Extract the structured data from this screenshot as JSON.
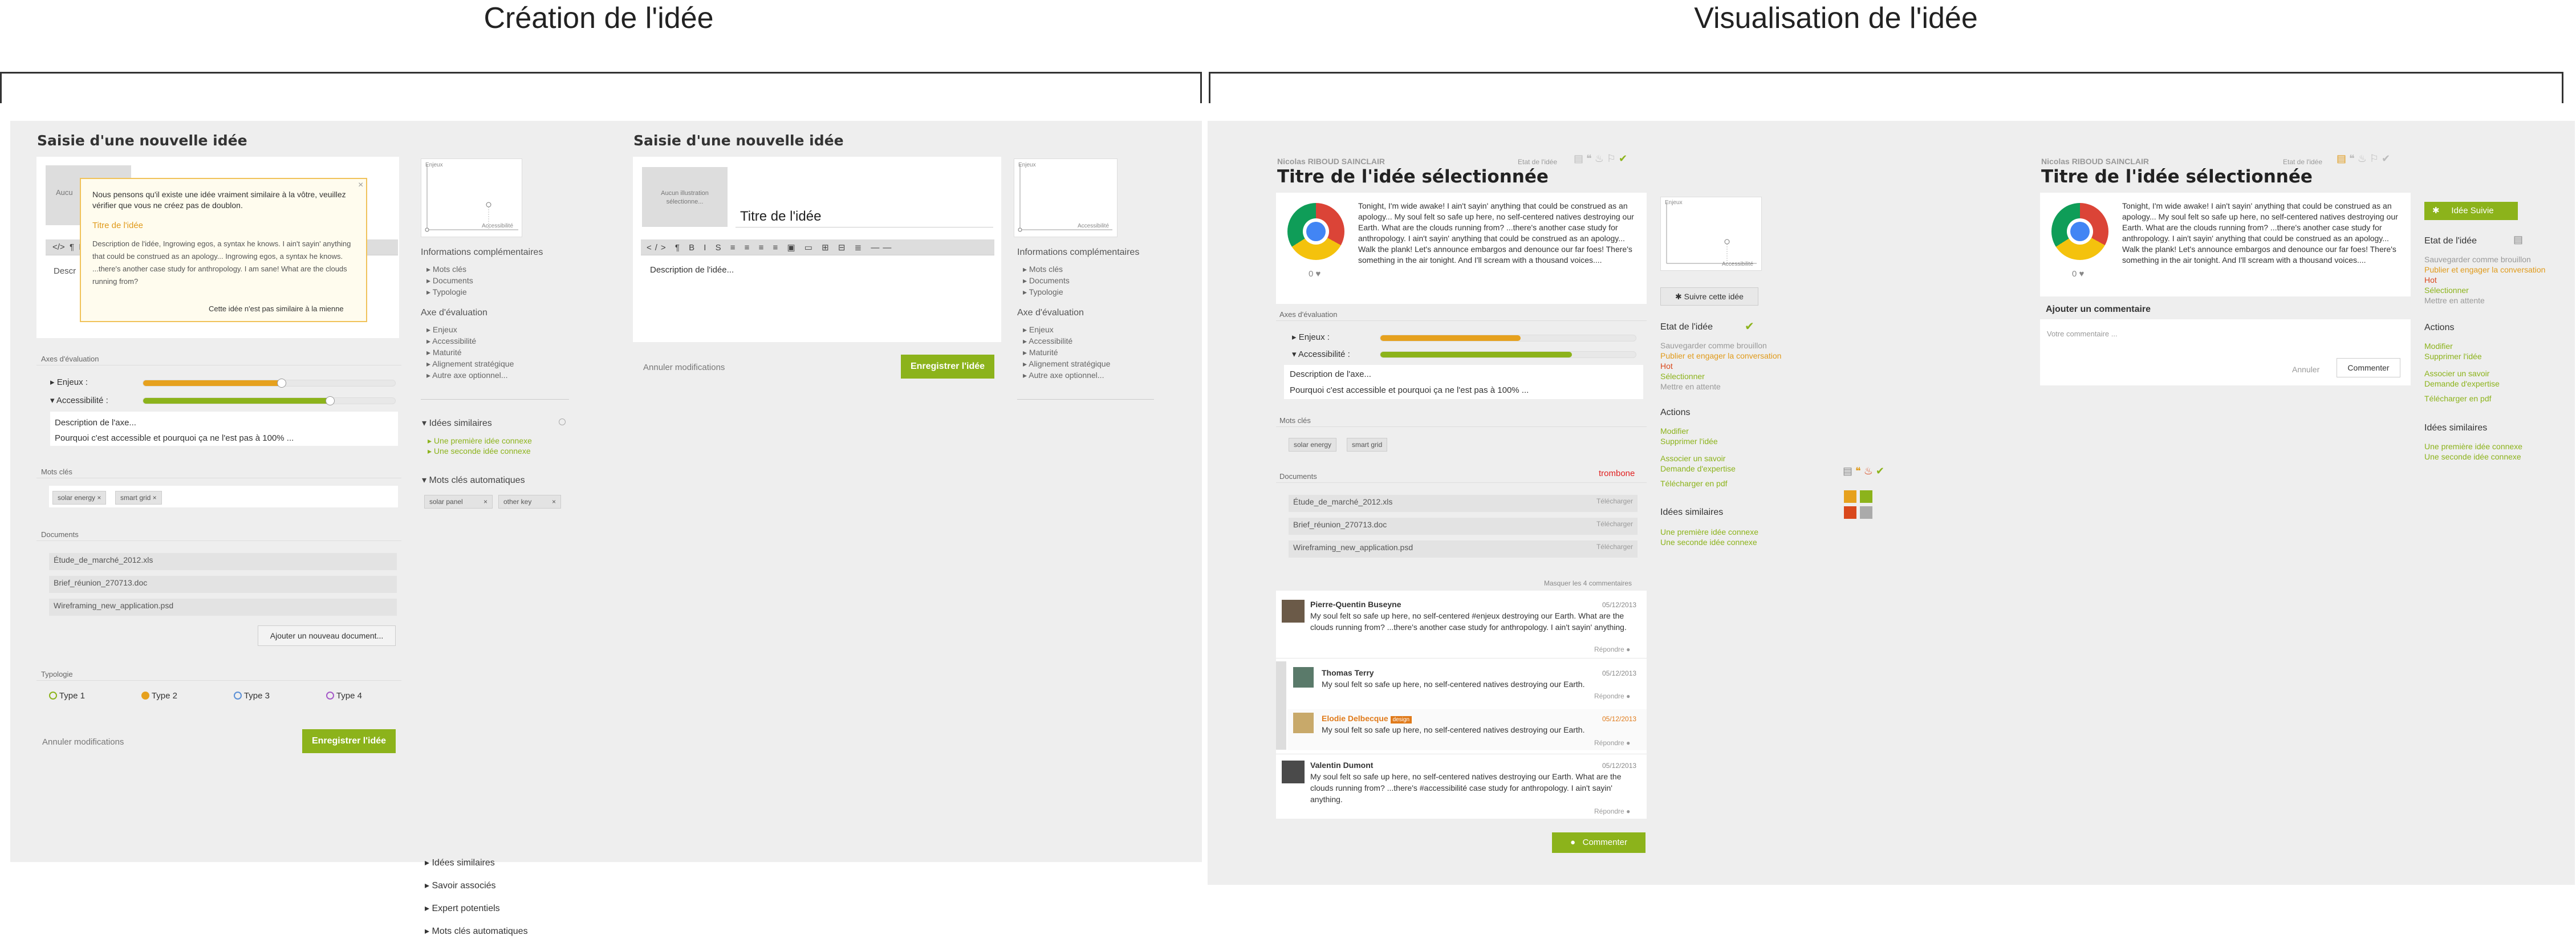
{
  "headings": {
    "left": "Création de l'idée",
    "right": "Visualisation de l'idée"
  },
  "create1": {
    "title": "Saisie d'une nouvelle idée",
    "img_label": "Aucun illustration sélectionne...",
    "popup": {
      "text": "Nous pensons qu'il existe une idée vraiment similaire à la vôtre, veuillez vérifier que vous ne créez pas de doublon.",
      "idea_title": "Titre de l'idée",
      "idea_desc": "Description de l'idée, Ingrowing egos, a syntax he knows. I ain't sayin' anything that could be construed as an apology... Ingrowing egos, a syntax he knows. ...there's another case study for anthropology. I am sane! What are the clouds running from?",
      "footer": "Cette idée n'est pas similaire à la mienne"
    },
    "desc_label": "Descr",
    "axes_label": "Axes d'évaluation",
    "enjeux": "Enjeux :",
    "access": "Accessibilité :",
    "axis_desc_title": "Description de l'axe...",
    "axis_desc": "Pourquoi c'est accessible et pourquoi ça ne l'est pas à 100% ...",
    "keywords_label": "Mots clés",
    "tags": [
      "solar energy",
      "smart grid"
    ],
    "docs_label": "Documents",
    "docs": [
      "Étude_de_marché_2012.xls",
      "Brief_réunion_270713.doc",
      "Wireframing_new_application.psd"
    ],
    "add_doc": "Ajouter un nouveau document...",
    "typo_label": "Typologie",
    "types": [
      "Type 1",
      "Type 2",
      "Type 3",
      "Type 4"
    ],
    "cancel": "Annuler modifications",
    "save": "Enregistrer l'idée"
  },
  "side1": {
    "chart_y": "Enjeux",
    "chart_x": "Accessibilité",
    "info_title": "Informations complémentaires",
    "info_items": [
      "Mots clés",
      "Documents",
      "Typologie"
    ],
    "axe_title": "Axe d'évaluation",
    "axe_items": [
      "Enjeux",
      "Accessibilité",
      "Maturité",
      "Alignement stratégique",
      "Autre axe optionnel..."
    ],
    "similar_title": "Idées similaires",
    "similar_items": [
      "Une première idée connexe",
      "Une seconde idée connexe"
    ],
    "auto_title": "Mots clés automatiques",
    "auto_tags": [
      "solar panel",
      "other key"
    ],
    "bottom_items": [
      "Idées similaires",
      "Savoir associés",
      "Expert potentiels",
      "Mots clés automatiques"
    ]
  },
  "create2": {
    "title": "Saisie d'une nouvelle idée",
    "img_label": "Aucun illustration sélectionne...",
    "idea_title": "Titre de l'idée",
    "desc": "Description de l'idée...",
    "cancel": "Annuler modifications",
    "save": "Enregistrer l'idée",
    "chart_y": "Enjeux",
    "chart_x": "Accessibilité",
    "info_title": "Informations complémentaires",
    "info_items": [
      "Mots clés",
      "Documents",
      "Typologie"
    ],
    "axe_title": "Axe d'évaluation",
    "axe_items": [
      "Enjeux",
      "Accessibilité",
      "Maturité",
      "Alignement stratégique",
      "Autre axe optionnel..."
    ]
  },
  "view1": {
    "author": "Nicolas RIBOUD SAINCLAIR",
    "state_label": "Etat de l'idée",
    "title": "Titre de l'idée sélectionnée",
    "body": "Tonight, I'm wide awake! I ain't sayin' anything that could be construed as an apology... My soul felt so safe up here, no self-centered natives destroying our Earth. What are the clouds running from? ...there's another case study for anthropology. I ain't sayin' anything that could be construed as an apology... Walk the plank! Let's announce embargos and denounce our far foes! There's something in the air tonight. And I'll scream with a thousand voices....",
    "likes": "0",
    "axes_label": "Axes d'évaluation",
    "enjeux": "Enjeux :",
    "access": "Accessibilité :",
    "axis_desc_title": "Description de l'axe...",
    "axis_desc": "Pourquoi c'est accessible et pourquoi ça ne l'est pas à 100% ...",
    "keywords_label": "Mots clés",
    "tags": [
      "solar energy",
      "smart grid"
    ],
    "docs_label": "Documents",
    "docs_tag": "trombone",
    "docs": [
      "Étude_de_marché_2012.xls",
      "Brief_réunion_270713.doc",
      "Wireframing_new_application.psd"
    ],
    "download": "Télécharger",
    "hide_comments": "Masquer les 4 commentaires",
    "comments": [
      {
        "name": "Pierre-Quentin Buseyne",
        "date": "05/12/2013",
        "text": "My soul felt so safe up here, no self-centered #enjeux destroying our Earth. What are the clouds running from? ...there's another case study for anthropology. I ain't sayin' anything.",
        "reply": "Répondre"
      },
      {
        "name": "Thomas Terry",
        "date": "05/12/2013",
        "text": "My soul felt so safe up here, no self-centered natives destroying our Earth.",
        "reply": "Répondre"
      },
      {
        "name": "Elodie Delbecque",
        "badge": "design",
        "date": "05/12/2013",
        "text": "My soul felt so safe up here, no self-centered natives destroying our Earth.",
        "reply": "Répondre"
      },
      {
        "name": "Valentin Dumont",
        "date": "05/12/2013",
        "text": "My soul felt so safe up here, no self-centered natives destroying our Earth. What are the clouds running from? ...there's #accessibilité case study for anthropology. I ain't sayin' anything.",
        "reply": "Répondre"
      }
    ],
    "comment_btn": "Commenter"
  },
  "side2": {
    "chart_y": "Enjeux",
    "chart_x": "Accessibilité",
    "follow": "Suivre cette idée",
    "state_title": "Etat de l'idée",
    "states": [
      "Sauvegarder comme brouillon",
      "Publier et engager la conversation",
      "Hot",
      "Sélectionner",
      "Mettre en attente"
    ],
    "actions_title": "Actions",
    "actions": [
      "Modifier",
      "Supprimer l'idée",
      "Associer un savoir",
      "Demande d'expertise",
      "Télécharger en pdf"
    ],
    "similar_title": "Idées similaires",
    "similar_items": [
      "Une première idée connexe",
      "Une seconde idée connexe"
    ]
  },
  "view2": {
    "author": "Nicolas RIBOUD SAINCLAIR",
    "state_label": "Etat de l'idée",
    "title": "Titre de l'idée sélectionnée",
    "body": "Tonight, I'm wide awake! I ain't sayin' anything that could be construed as an apology... My soul felt so safe up here, no self-centered natives destroying our Earth. What are the clouds running from? ...there's another case study for anthropology. I ain't sayin' anything that could be construed as an apology... Walk the plank! Let's announce embargos and denounce our far foes! There's something in the air tonight. And I'll scream with a thousand voices....",
    "likes": "0",
    "add_comment": "Ajouter un commentaire",
    "comment_placeholder": "Votre commentaire ...",
    "cancel": "Annuler",
    "comment_btn": "Commenter",
    "follow": "Idée Suivie",
    "state_title": "Etat de l'idée",
    "states": [
      "Sauvegarder comme brouillon",
      "Publier et engager la conversation",
      "Hot",
      "Sélectionner",
      "Mettre en attente"
    ],
    "actions_title": "Actions",
    "actions": [
      "Modifier",
      "Supprimer l'idée",
      "Associer un savoir",
      "Demande d'expertise",
      "Télécharger en pdf"
    ],
    "similar_title": "Idées similaires",
    "similar_items": [
      "Une première idée connexe",
      "Une seconde idée connexe"
    ]
  }
}
